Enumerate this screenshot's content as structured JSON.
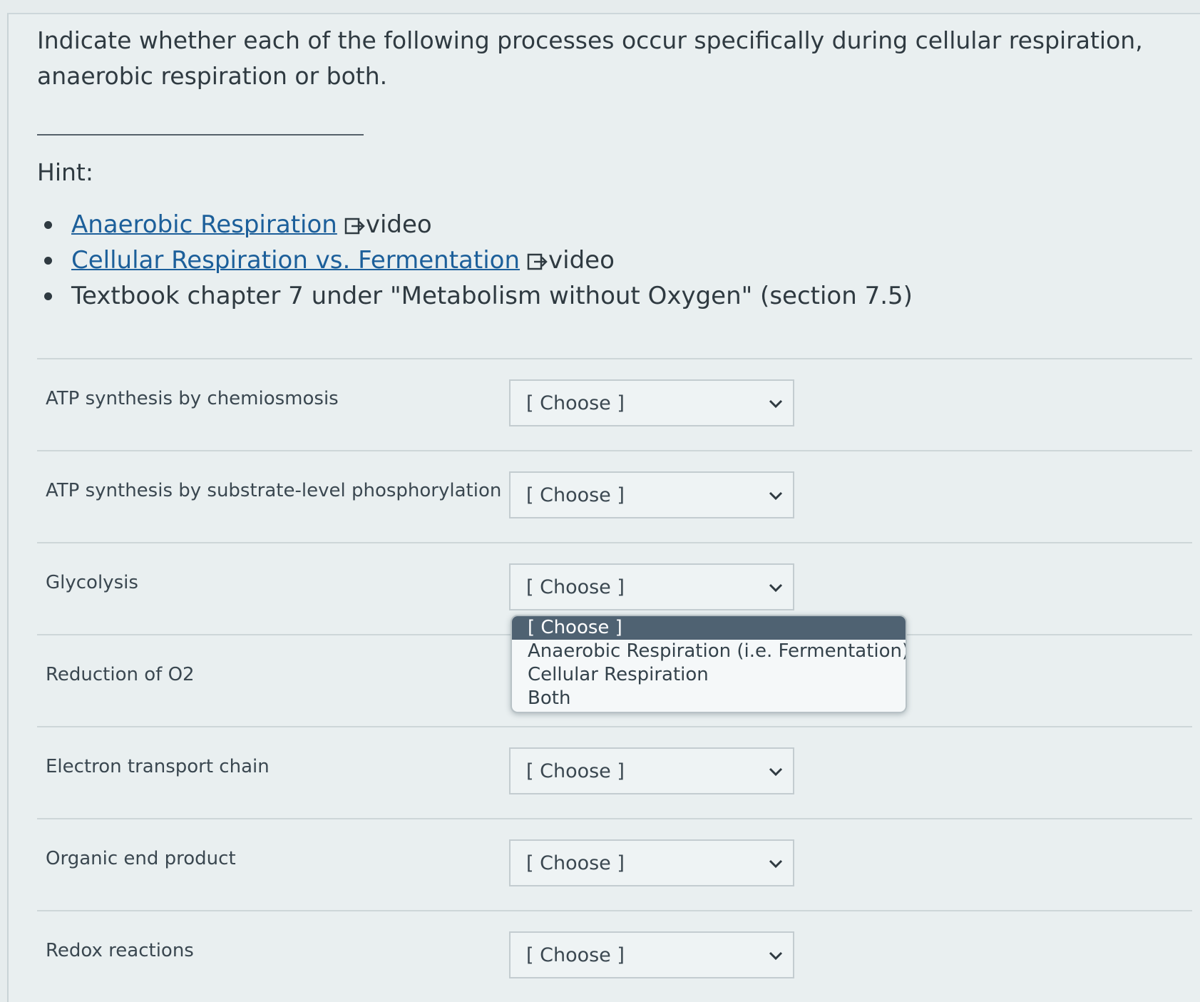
{
  "question": {
    "text": "Indicate whether each of the following processes occur specifically during cellular respiration, anaerobic respiration or both."
  },
  "hint": {
    "label": "Hint:",
    "items": [
      {
        "link": "Anaerobic Respiration",
        "suffix": "video"
      },
      {
        "link": "Cellular Respiration vs. Fermentation",
        "suffix": "video"
      },
      {
        "text": "Textbook chapter 7 under \"Metabolism without Oxygen\" (section 7.5)"
      }
    ]
  },
  "rows": [
    {
      "label": "ATP synthesis by chemiosmosis",
      "value": "[ Choose ]"
    },
    {
      "label": "ATP synthesis by substrate-level phosphorylation",
      "value": "[ Choose ]"
    },
    {
      "label": "Glycolysis",
      "value": "[ Choose ]"
    },
    {
      "label": "Reduction of O2",
      "value": "[ Choose ]"
    },
    {
      "label": "Electron transport chain",
      "value": "[ Choose ]"
    },
    {
      "label": "Organic end product",
      "value": "[ Choose ]"
    },
    {
      "label": "Redox reactions",
      "value": "[ Choose ]"
    }
  ],
  "dropdown": {
    "options": [
      "[ Choose ]",
      "Anaerobic Respiration (i.e. Fermentation)",
      "Cellular Respiration",
      "Both"
    ],
    "selected_index": 0
  },
  "icons": {
    "external_link": "external-link-icon",
    "chevron": "chevron-down-icon"
  },
  "colors": {
    "link": "#1c5f9a",
    "selected_option_bg": "#4f6272"
  }
}
